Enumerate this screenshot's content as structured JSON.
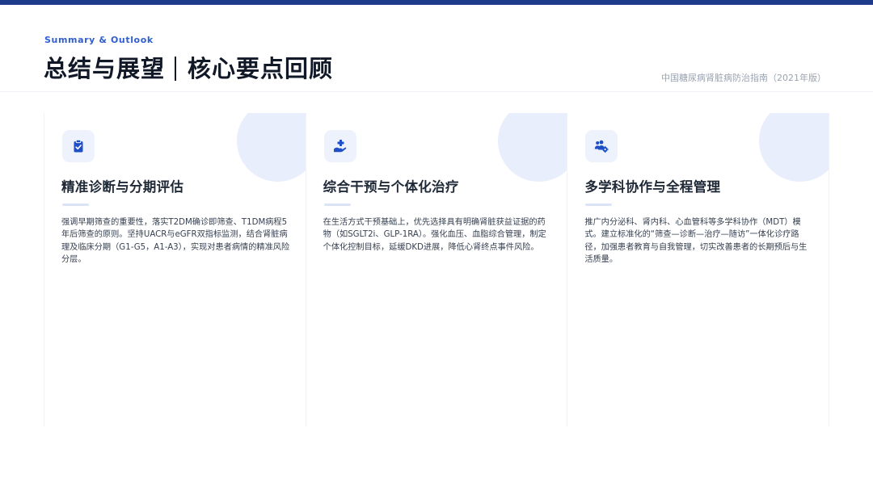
{
  "header": {
    "eyebrow": "Summary & Outlook",
    "title_part1": "总结与展望",
    "title_part2": "核心要点回顾",
    "source": "中国糖尿病肾脏病防治指南（2021年版）"
  },
  "cards": [
    {
      "icon": "clipboard-check-icon",
      "title": "精准诊断与分期评估",
      "text": "强调早期筛查的重要性，落实T2DM确诊即筛查、T1DM病程5年后筛查的原则。坚持UACR与eGFR双指标监测，结合肾脏病理及临床分期（G1-G5，A1-A3），实现对患者病情的精准风险分层。"
    },
    {
      "icon": "hand-holding-medical-icon",
      "title": "综合干预与个体化治疗",
      "text": "在生活方式干预基础上，优先选择具有明确肾脏获益证据的药物（如SGLT2i、GLP-1RA）。强化血压、血脂综合管理，制定个体化控制目标，延缓DKD进展，降低心肾终点事件风险。"
    },
    {
      "icon": "users-gear-icon",
      "title": "多学科协作与全程管理",
      "text": "推广内分泌科、肾内科、心血管科等多学科协作（MDT）模式。建立标准化的“筛查—诊断—治疗—随访”一体化诊疗路径，加强患者教育与自我管理，切实改善患者的长期预后与生活质量。"
    }
  ],
  "colors": {
    "accent": "#2f5fd0",
    "top_bar": "#1e3a8a",
    "icon_bg": "#edf2fd",
    "decor_circle": "#e8eefb"
  }
}
